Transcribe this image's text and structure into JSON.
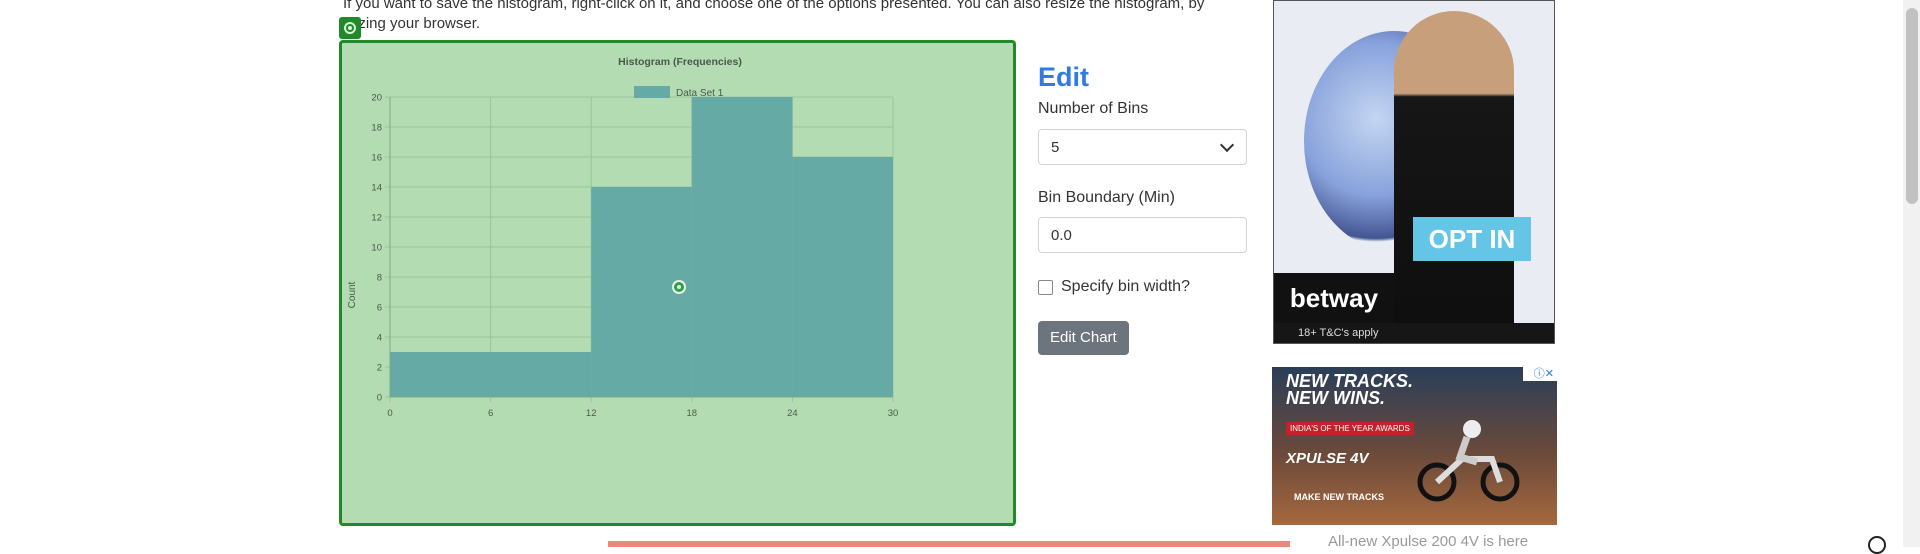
{
  "intro": {
    "line1": "If you want to save the histogram, right-click on it, and choose one of the options presented. You can also resize the histogram, by",
    "line2": "izing your browser."
  },
  "chart_data": {
    "type": "bar",
    "title": "Histogram (Frequencies)",
    "ylabel": "Count",
    "xlabel": "",
    "legend": "top-center",
    "bin_edges": [
      0,
      6,
      12,
      18,
      24,
      30
    ],
    "x_ticks": [
      "0",
      "6",
      "12",
      "18",
      "24",
      "30"
    ],
    "y_ticks": [
      "0",
      "2",
      "4",
      "6",
      "8",
      "10",
      "12",
      "14",
      "16",
      "18",
      "20"
    ],
    "xlim": [
      0,
      30
    ],
    "ylim": [
      0,
      20
    ],
    "grid": true,
    "series": [
      {
        "name": "Data Set 1",
        "values": [
          3,
          3,
          14,
          20,
          16
        ],
        "color": "#66aaa6"
      }
    ],
    "background": "#b3dcb3",
    "border_color": "#1f8a2a"
  },
  "edit": {
    "title": "Edit",
    "bins_label": "Number of Bins",
    "bins_value": "5",
    "boundary_label": "Bin Boundary (Min)",
    "boundary_value": "0.0",
    "bin_width_label": "Specify bin width?",
    "button_label": "Edit Chart"
  },
  "ad1": {
    "cta": "OPT IN",
    "brand": "betway",
    "terms": "18+ T&C's apply"
  },
  "ad2": {
    "headline": "NEW TRACKS. NEW WINS.",
    "tag": "INDIA'S OF THE YEAR AWARDS",
    "model": "XPULSE 4V",
    "cta": "MAKE NEW TRACKS"
  },
  "bottom_text": "All-new Xpulse 200 4V is here"
}
